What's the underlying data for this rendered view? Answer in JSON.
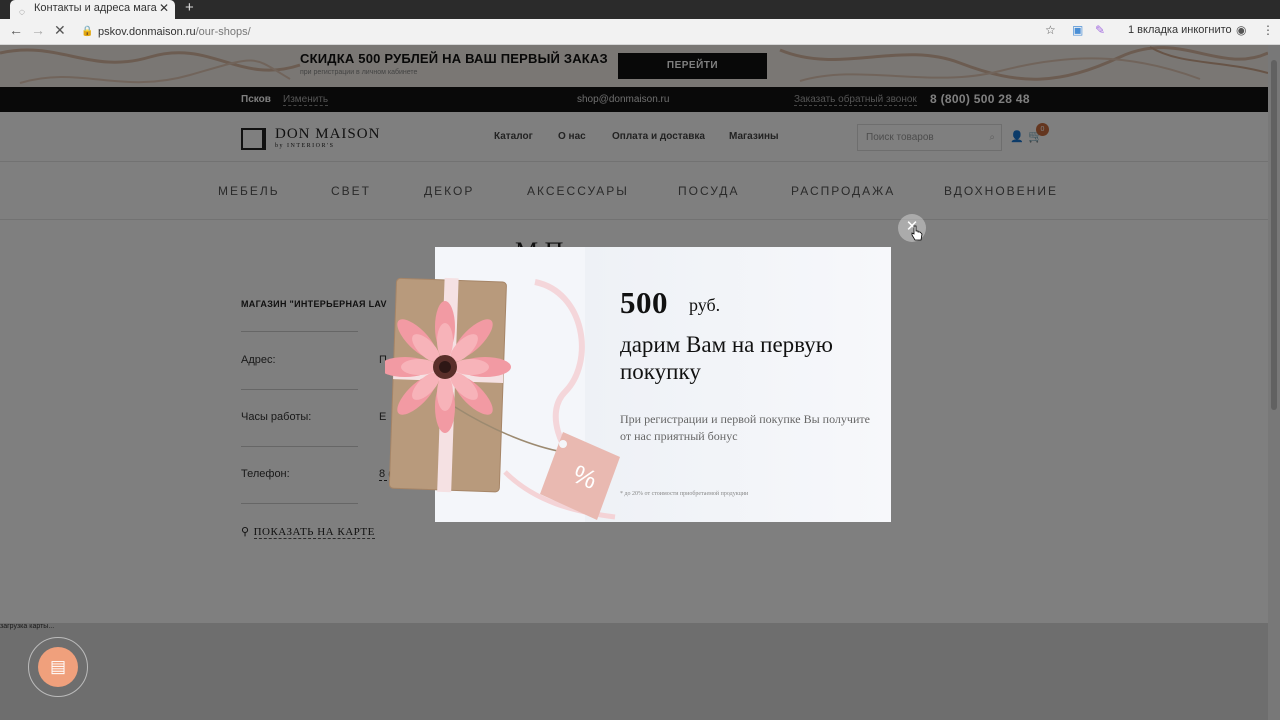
{
  "browser": {
    "tab_title": "Контакты и адреса мага",
    "tab_close": "✕",
    "new_tab": "+",
    "url_host": "pskov.donmaison.ru",
    "url_path": "/our-shops/",
    "incognito_text": "1 вкладка инкогнито"
  },
  "promo": {
    "title": "СКИДКА 500 РУБЛЕЙ НА ВАШ ПЕРВЫЙ ЗАКАЗ",
    "subtitle": "при регистрации в личном кабинете",
    "button": "ПЕРЕЙТИ"
  },
  "topbar": {
    "city": "Псков",
    "change": "Изменить",
    "email": "shop@donmaison.ru",
    "callback": "Заказать обратный звонок",
    "phone": "8 (800) 500 28 48"
  },
  "header": {
    "logo_text": "DON MAISON",
    "logo_sub": "by INTERIOR'S",
    "nav": [
      "Каталог",
      "О нас",
      "Оплата и доставка",
      "Магазины"
    ],
    "search_placeholder": "Поиск товаров",
    "cart_count": "0"
  },
  "categories": [
    "МЕБЕЛЬ",
    "СВЕТ",
    "ДЕКОР",
    "АКСЕССУАРЫ",
    "ПОСУДА",
    "РАСПРОДАЖА",
    "ВДОХНОВЕНИЕ"
  ],
  "content": {
    "page_title": "М          П",
    "shop_name": "МАГАЗИН \"ИНТЕРЬЕРНАЯ LAV",
    "address_label": "Адрес:",
    "address_value": "П",
    "hours_label": "Часы работы:",
    "hours_value": "Е",
    "phone_label": "Телефон:",
    "phone_value": "8 (",
    "map_link": "ПОКАЗАТЬ НА КАРТЕ",
    "map_loading": "загрузка карты..."
  },
  "modal": {
    "amount": "500",
    "currency": "руб.",
    "title": "дарим Вам на первую покупку",
    "description": "При регистрации и первой покупке Вы получите от нас приятный бонус",
    "footnote": "* до 20% от стоимости приобретаемой продукции",
    "close": "✕",
    "tag_text": "%"
  },
  "colors": {
    "accent_black": "#111111",
    "cart_badge": "#c96d3e",
    "chat_button": "#f0a07c",
    "flower": "#f29aa3"
  }
}
